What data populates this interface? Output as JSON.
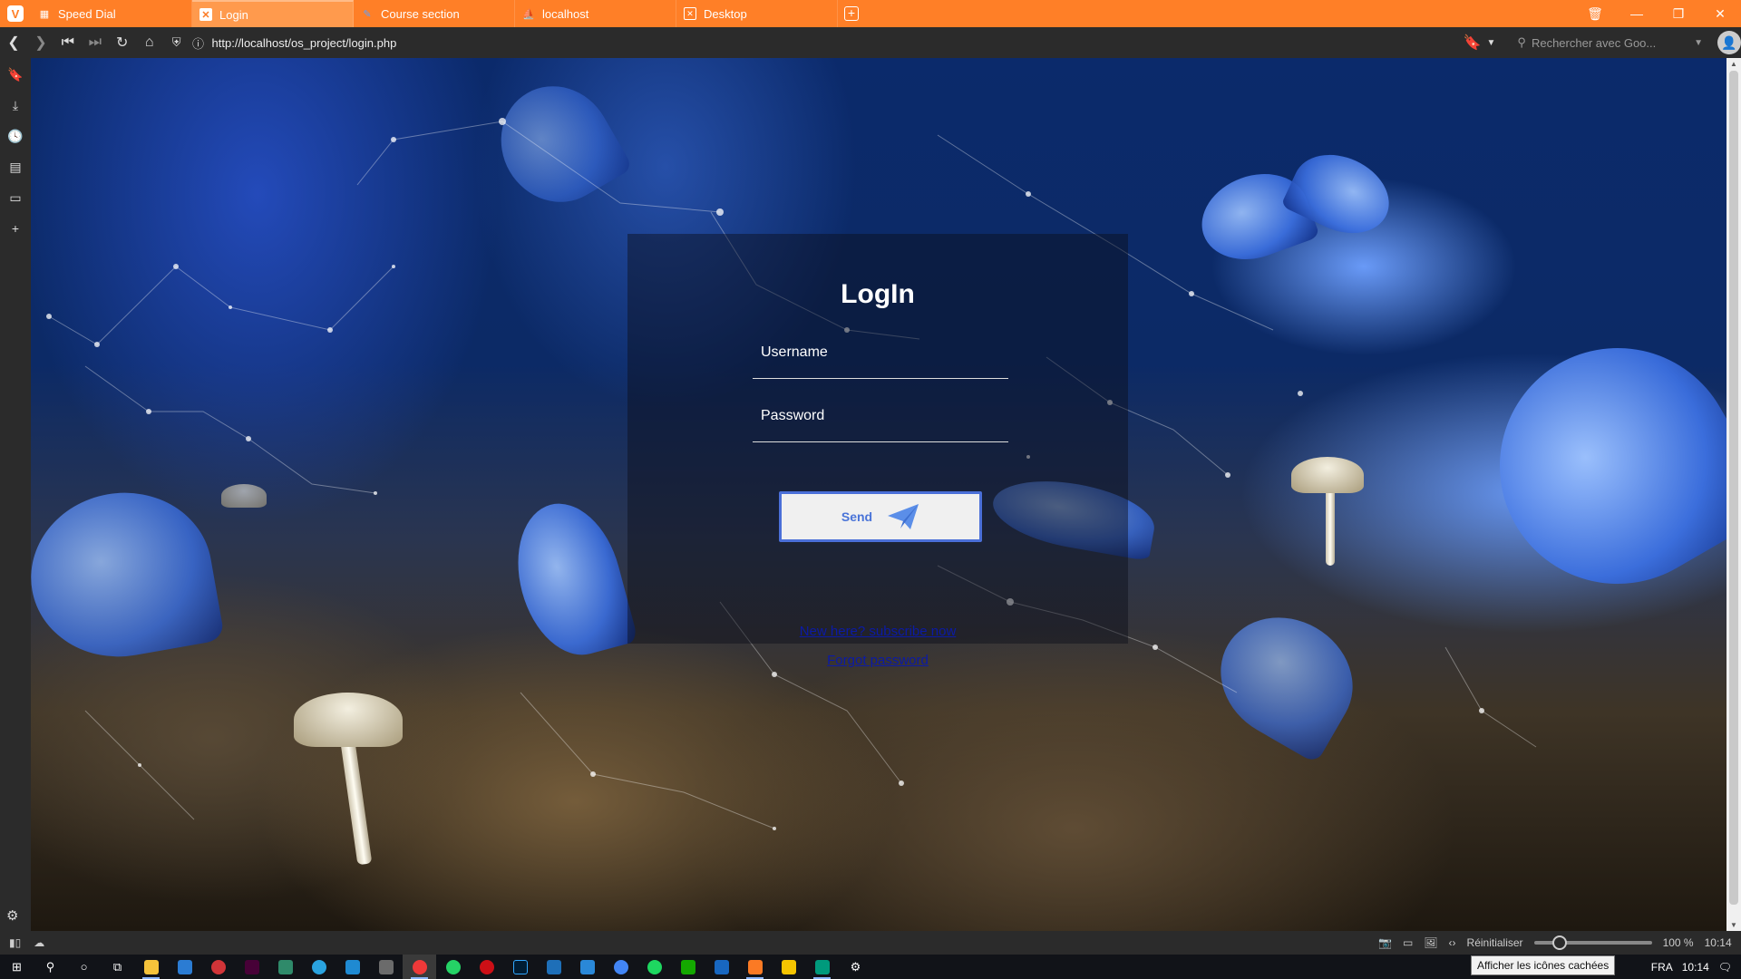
{
  "browser": {
    "tabs": [
      {
        "label": "Speed Dial",
        "active": false,
        "icon": "grid-icon"
      },
      {
        "label": "Login",
        "active": true,
        "icon": "xampp-icon"
      },
      {
        "label": "Course section",
        "active": false,
        "icon": "feather-icon"
      },
      {
        "label": "localhost",
        "active": false,
        "icon": "phpmyadmin-icon"
      },
      {
        "label": "Desktop",
        "active": false,
        "icon": "xampp-icon"
      }
    ],
    "url": "http://localhost/os_project/login.php",
    "search_placeholder": "Rechercher avec Goo...",
    "accent_color": "#ff7f27"
  },
  "login": {
    "title": "LogIn",
    "username_label": "Username",
    "password_label": "Password",
    "send_label": "Send",
    "subscribe_link": "New here? subscribe now",
    "forgot_link": "Forgot password"
  },
  "statusbar": {
    "reset_label": "Réinitialiser",
    "zoom": "100 %",
    "time": "10:14"
  },
  "taskbar": {
    "language": "FRA",
    "time": "10:14",
    "tooltip": "Afficher les icônes cachées"
  }
}
